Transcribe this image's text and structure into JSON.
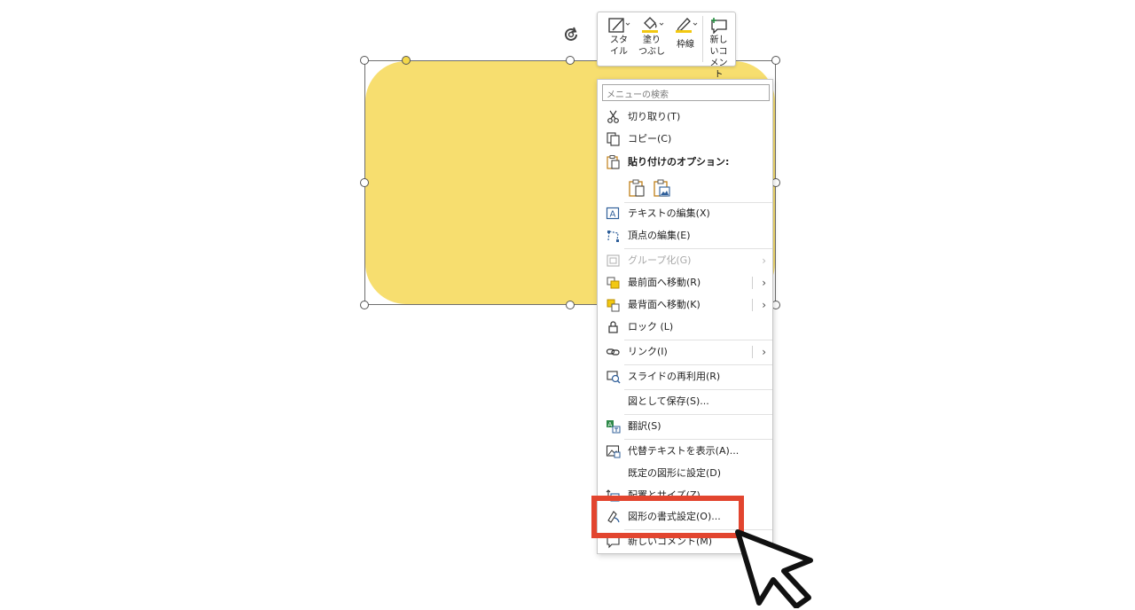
{
  "mini_toolbar": {
    "style_label": "スタイル",
    "fill_label": "塗りつぶし",
    "outline_label": "枠線",
    "comment_label": "新しいコメント",
    "accent_color": "#f2c811"
  },
  "shape": {
    "fill_color": "#f7de6f"
  },
  "menu": {
    "search_placeholder": "メニューの検索",
    "items": [
      {
        "label": "切り取り(T)",
        "icon": "scissors-icon"
      },
      {
        "label": "コピー(C)",
        "icon": "copy-icon"
      },
      {
        "label": "貼り付けのオプション:",
        "icon": "paste-icon"
      },
      {
        "label": "テキストの編集(X)",
        "icon": "edit-text-icon"
      },
      {
        "label": "頂点の編集(E)",
        "icon": "edit-points-icon"
      },
      {
        "label": "グループ化(G)",
        "icon": "group-icon"
      },
      {
        "label": "最前面へ移動(R)",
        "icon": "bring-to-front-icon"
      },
      {
        "label": "最背面へ移動(K)",
        "icon": "send-to-back-icon"
      },
      {
        "label": "ロック (L)",
        "icon": "lock-icon"
      },
      {
        "label": "リンク(I)",
        "icon": "link-icon"
      },
      {
        "label": "スライドの再利用(R)",
        "icon": "reuse-slides-icon"
      },
      {
        "label": "図として保存(S)...",
        "icon": ""
      },
      {
        "label": "翻訳(S)",
        "icon": "translate-icon"
      },
      {
        "label": "代替テキストを表示(A)...",
        "icon": "alt-text-icon"
      },
      {
        "label": "既定の図形に設定(D)",
        "icon": ""
      },
      {
        "label": "配置とサイズ(Z)...",
        "icon": "size-position-icon"
      },
      {
        "label": "図形の書式設定(O)...",
        "icon": "format-shape-icon"
      },
      {
        "label": "新しいコメント(M)",
        "icon": "comment-icon"
      }
    ]
  },
  "highlight_color": "#e2452f"
}
